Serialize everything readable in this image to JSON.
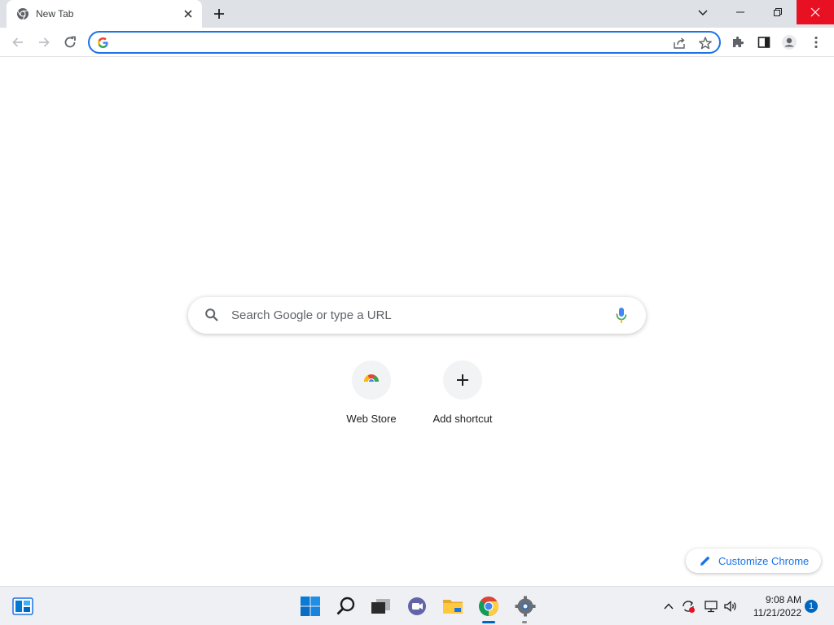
{
  "tab": {
    "title": "New Tab"
  },
  "omnibox": {
    "value": ""
  },
  "ntp": {
    "search_placeholder": "Search Google or type a URL",
    "shortcuts": [
      {
        "label": "Web Store"
      },
      {
        "label": "Add shortcut"
      }
    ],
    "customize_label": "Customize Chrome"
  },
  "taskbar": {
    "time": "9:08 AM",
    "date": "11/21/2022",
    "notification_count": "1"
  },
  "icons": [
    "chrome-icon",
    "close-icon",
    "plus-icon",
    "chevron-down-icon",
    "minimize-icon",
    "restore-icon",
    "back-icon",
    "forward-icon",
    "reload-icon",
    "google-g-icon",
    "share-icon",
    "star-icon",
    "extensions-icon",
    "side-panel-icon",
    "profile-icon",
    "kebab-menu-icon",
    "search-icon",
    "mic-icon",
    "webstore-icon",
    "pencil-icon",
    "widgets-icon",
    "windows-start-icon",
    "taskbar-search-icon",
    "task-view-icon",
    "chat-icon",
    "file-explorer-icon",
    "settings-icon",
    "chevron-up-icon",
    "sync-icon",
    "network-icon",
    "volume-icon"
  ],
  "colors": {
    "accent": "#1a73e8",
    "close_button": "#e81123",
    "titlebar": "#dee1e6",
    "taskbar": "#eef0f4"
  }
}
